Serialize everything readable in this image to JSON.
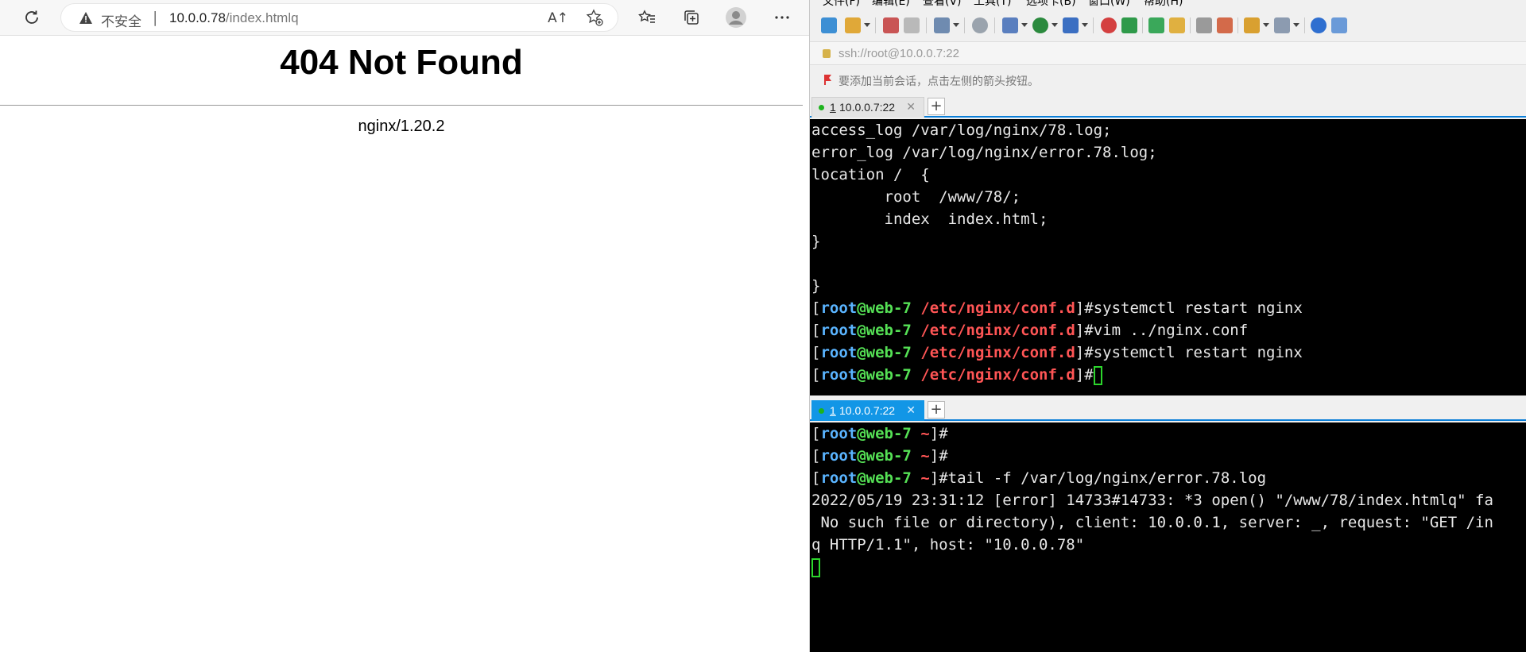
{
  "browser": {
    "insecure_label": "不安全",
    "separator": "|",
    "url_host": "10.0.0.78",
    "url_path": "/index.htmlq",
    "read_aloud": "A↑",
    "page": {
      "heading": "404 Not Found",
      "server": "nginx/1.20.2"
    }
  },
  "xshell": {
    "menu": [
      "文件(F)",
      "编辑(E)",
      "查看(V)",
      "工具(T)",
      "选项卡(B)",
      "窗口(W)",
      "帮助(H)"
    ],
    "address": "ssh://root@10.0.0.7:22",
    "hint": "要添加当前会话，点击左侧的箭头按钮。",
    "tabs": [
      {
        "number": "1",
        "label": "10.0.0.7:22",
        "active": false
      },
      {
        "number": "1",
        "label": "10.0.0.7:22",
        "active": true
      }
    ],
    "terminal1": [
      "access_log /var/log/nginx/78.log;",
      "error_log /var/log/nginx/error.78.log;",
      "location /  {",
      "        root  /www/78/;",
      "        index  index.html;",
      "}",
      "",
      "}"
    ],
    "terminal1_prompts": [
      {
        "user": "root",
        "host": "web-7",
        "path": "/etc/nginx/conf.d",
        "cmd": "systemctl restart nginx"
      },
      {
        "user": "root",
        "host": "web-7",
        "path": "/etc/nginx/conf.d",
        "cmd": "vim ../nginx.conf"
      },
      {
        "user": "root",
        "host": "web-7",
        "path": "/etc/nginx/conf.d",
        "cmd": "systemctl restart nginx"
      },
      {
        "user": "root",
        "host": "web-7",
        "path": "/etc/nginx/conf.d",
        "cmd": ""
      }
    ],
    "terminal2_prompts": [
      {
        "user": "root",
        "host": "web-7",
        "path": "~",
        "cmd": ""
      },
      {
        "user": "root",
        "host": "web-7",
        "path": "~",
        "cmd": ""
      },
      {
        "user": "root",
        "host": "web-7",
        "path": "~",
        "cmd": "tail -f /var/log/nginx/error.78.log"
      }
    ],
    "terminal2_output": [
      "2022/05/19 23:31:12 [error] 14733#14733: *3 open() \"/www/78/index.htmlq\" fa",
      " No such file or directory), client: 10.0.0.1, server: _, request: \"GET /in",
      "q HTTP/1.1\", host: \"10.0.0.78\""
    ]
  }
}
